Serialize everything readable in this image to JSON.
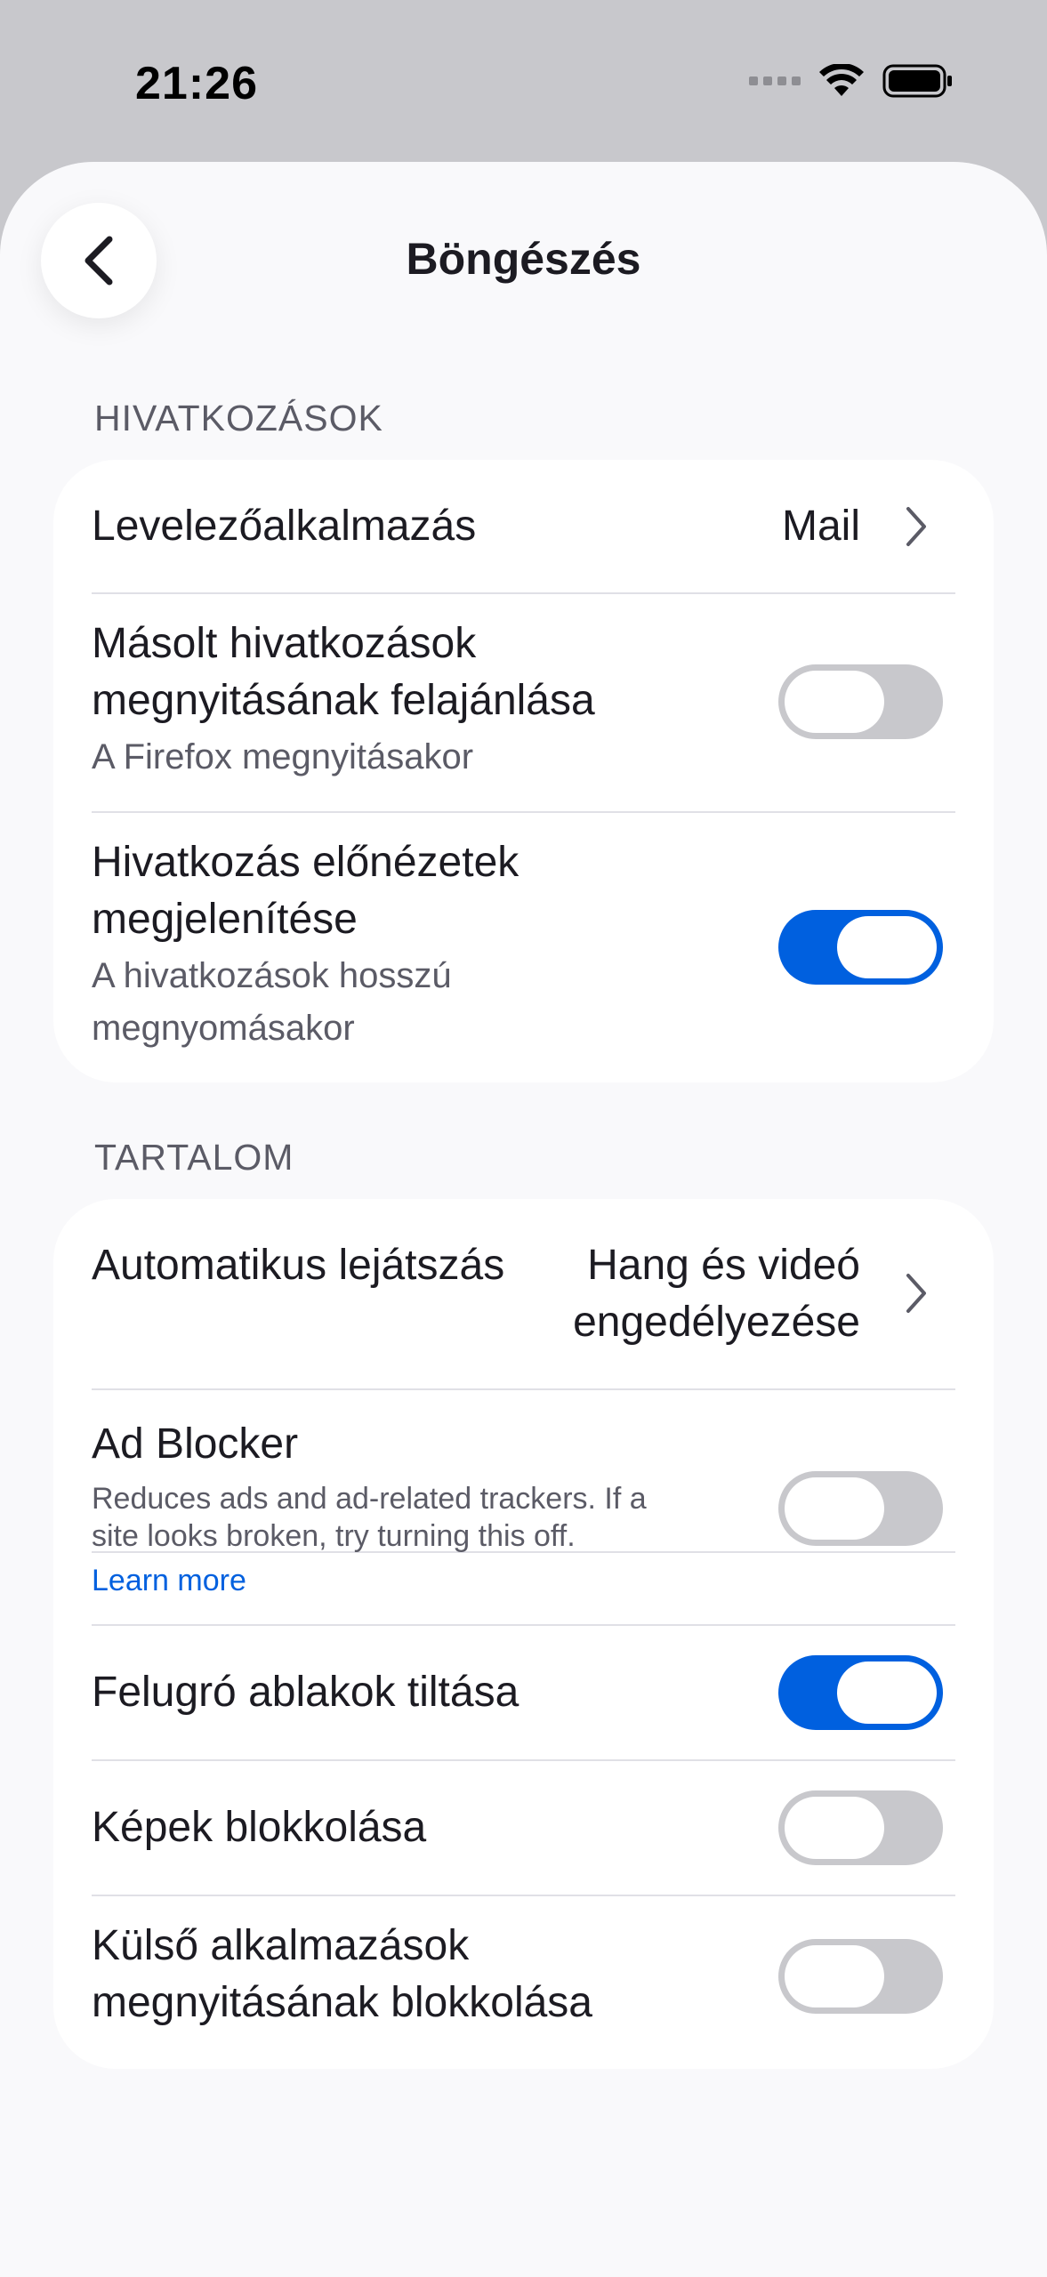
{
  "status_bar": {
    "time": "21:26",
    "icons": [
      "cellular-signal-icon",
      "wifi-icon",
      "battery-icon"
    ]
  },
  "header": {
    "title": "Böngészés",
    "back_icon": "chevron-left-icon"
  },
  "sections": {
    "links": {
      "header": "HIVATKOZÁSOK",
      "mail_app": {
        "title": "Levelezőalkalmazás",
        "value": "Mail"
      },
      "offer_copied": {
        "title_line1": "Másolt hivatkozások",
        "title_line2": "megnyitásának felajánlása",
        "subtitle": "A Firefox megnyitásakor",
        "enabled": false
      },
      "link_previews": {
        "title_line1": "Hivatkozás előnézetek",
        "title_line2": "megjelenítése",
        "subtitle_line1": "A hivatkozások hosszú",
        "subtitle_line2": "megnyomásakor",
        "enabled": true
      }
    },
    "content": {
      "header": "TARTALOM",
      "autoplay": {
        "title": "Automatikus lejátszás",
        "value_line1": "Hang és videó",
        "value_line2": "engedélyezése"
      },
      "ad_blocker": {
        "title": "Ad Blocker",
        "description_line1": "Reduces ads and ad-related trackers. If a",
        "description_line2": "site looks broken, try turning this off.",
        "link": "Learn more",
        "enabled": false
      },
      "block_popups": {
        "title": "Felugró ablakok tiltása",
        "enabled": true
      },
      "block_images": {
        "title": "Képek blokkolása",
        "enabled": false
      },
      "block_external_apps": {
        "title_line1": "Külső alkalmazások",
        "title_line2": "megnyitásának blokkolása",
        "enabled": false
      }
    }
  },
  "colors": {
    "accent": "#0060df",
    "toggle_off": "#c8c8cc",
    "background": "#f9f9fb",
    "card": "#ffffff",
    "secondary_text": "#5b5b66"
  }
}
